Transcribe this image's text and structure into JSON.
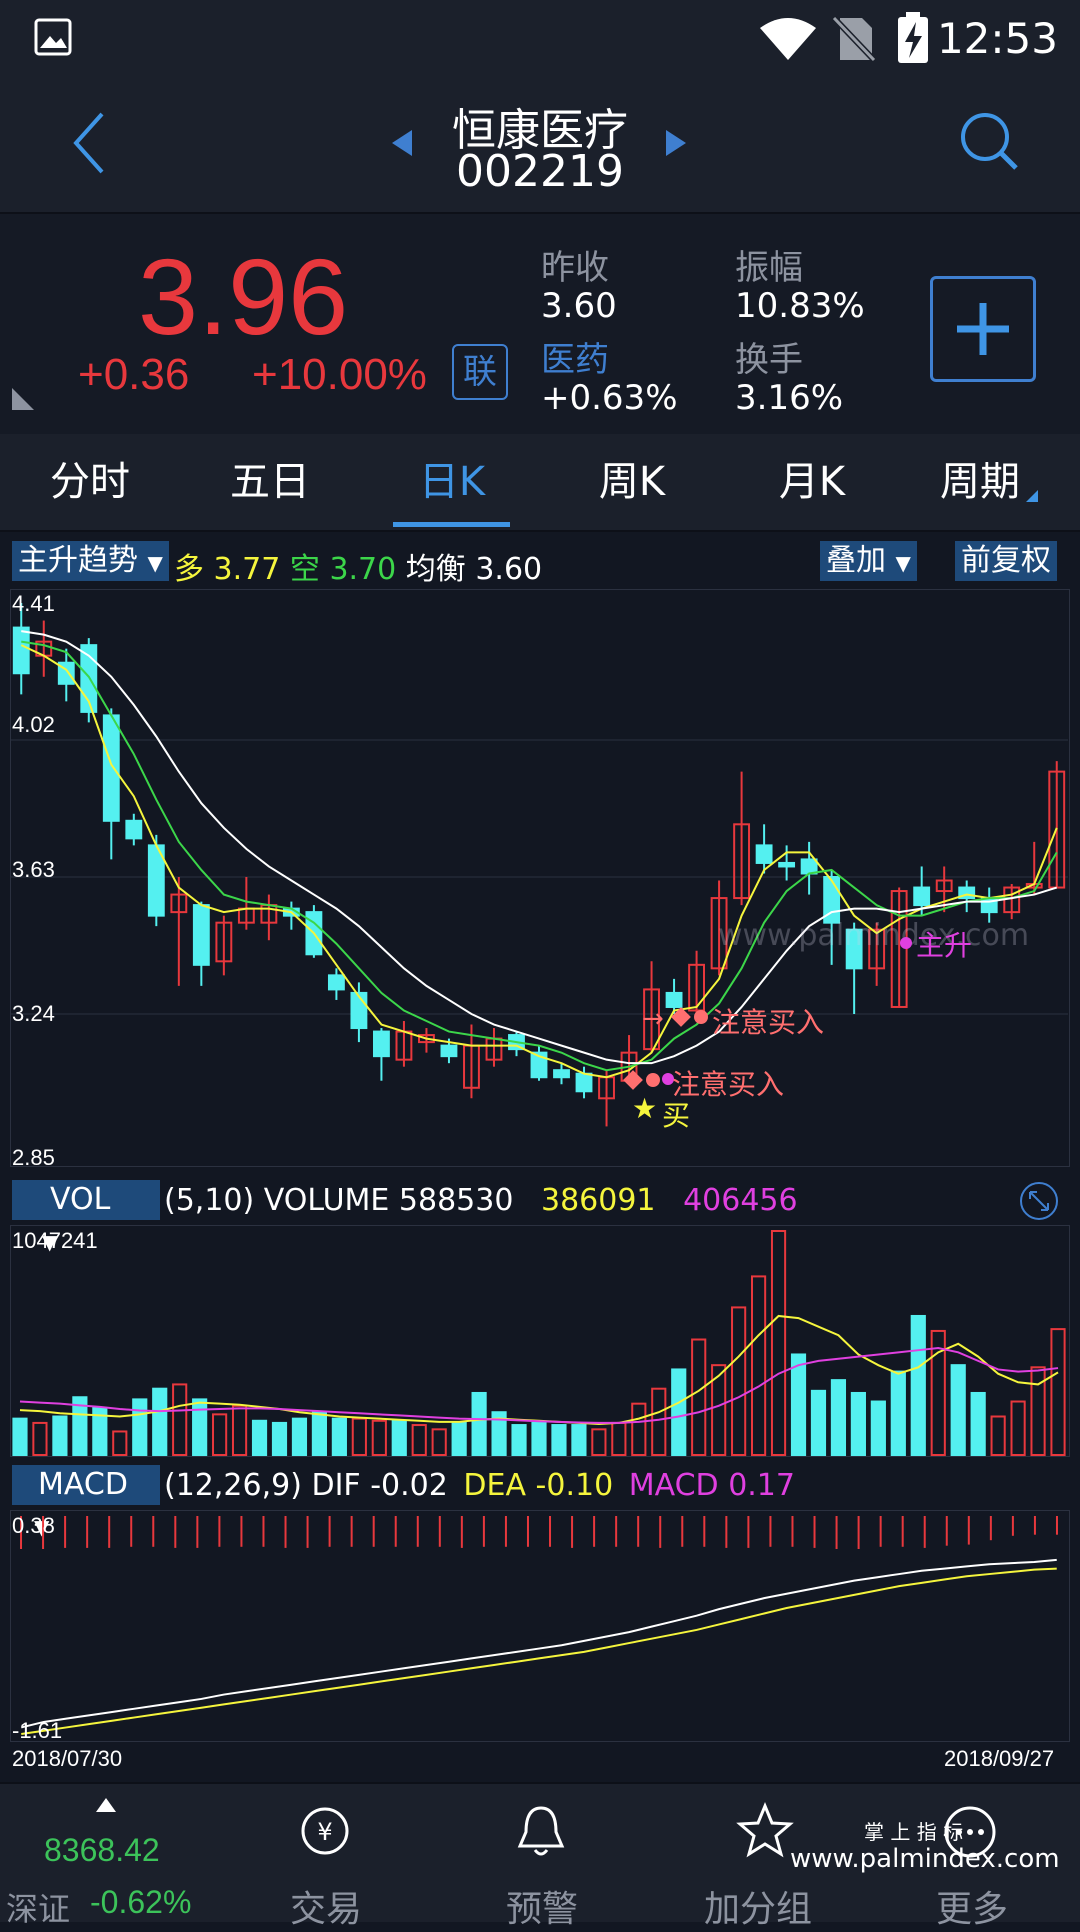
{
  "status": {
    "time": "12:53"
  },
  "header": {
    "stock_name": "恒康医疗",
    "stock_code": "002219"
  },
  "quote": {
    "price": "3.96",
    "change": "+0.36",
    "change_pct": "+10.00%",
    "lian_label": "联",
    "prev_close_label": "昨收",
    "prev_close": "3.60",
    "amplitude_label": "振幅",
    "amplitude": "10.83%",
    "sector_label": "医药",
    "sector_change": "+0.63%",
    "turnover_label": "换手",
    "turnover": "3.16%"
  },
  "tabs": [
    "分时",
    "五日",
    "日K",
    "周K",
    "月K",
    "周期"
  ],
  "active_tab": "日K",
  "main_indicator": {
    "selector": "主升趋势",
    "duo_label": "多",
    "duo_value": "3.77",
    "kong_label": "空",
    "kong_value": "3.70",
    "junheng_label": "均衡",
    "junheng_value": "3.60",
    "overlay_btn": "叠加",
    "adjust_btn": "前复权"
  },
  "vol_indicator": {
    "selector": "VOL",
    "params": "(5,10) VOLUME",
    "volume": "588530",
    "ma5": "386091",
    "ma10": "406456"
  },
  "macd_indicator": {
    "selector": "MACD",
    "params": "(12,26,9)",
    "dif_label": "DIF",
    "dif": "-0.02",
    "dea_label": "DEA",
    "dea": "-0.10",
    "macd_label": "MACD",
    "macd": "0.17"
  },
  "annotations": {
    "signal1": "注意买入",
    "signal2": "注意买入",
    "buy": "买",
    "zhusheng": "主升"
  },
  "dates": {
    "start": "2018/07/30",
    "end": "2018/09/27"
  },
  "bottom_nav": {
    "index_value": "8368.42",
    "index_name": "深证",
    "index_change": "-0.62%",
    "items": [
      "交易",
      "预警",
      "加分组",
      "更多"
    ]
  },
  "watermarks": {
    "center": "www.palmindex.com",
    "corner_title": "掌 上 指 标",
    "corner_url": "www.palmindex.com"
  },
  "colors": {
    "up": "#e8383d",
    "down": "#54f0f0",
    "accent": "#3f95e5",
    "ma_yellow": "#f5f53d",
    "ma_green": "#3cd64a",
    "ma_white": "#ffffff",
    "ma_magenta": "#e040e0"
  },
  "chart_data": [
    {
      "type": "candlestick",
      "title": "日K",
      "y_ticks": [
        "4.41",
        "4.02",
        "3.63",
        "3.24",
        "2.85"
      ],
      "ylim": [
        2.85,
        4.41
      ],
      "candles": [
        {
          "o": 4.34,
          "c": 4.21,
          "h": 4.41,
          "l": 4.15
        },
        {
          "o": 4.26,
          "c": 4.3,
          "h": 4.36,
          "l": 4.2
        },
        {
          "o": 4.24,
          "c": 4.18,
          "h": 4.28,
          "l": 4.13
        },
        {
          "o": 4.29,
          "c": 4.1,
          "h": 4.31,
          "l": 4.07
        },
        {
          "o": 4.09,
          "c": 3.79,
          "h": 4.11,
          "l": 3.68
        },
        {
          "o": 3.79,
          "c": 3.74,
          "h": 3.81,
          "l": 3.72
        },
        {
          "o": 3.72,
          "c": 3.52,
          "h": 3.75,
          "l": 3.49
        },
        {
          "o": 3.53,
          "c": 3.58,
          "h": 3.63,
          "l": 3.32
        },
        {
          "o": 3.55,
          "c": 3.38,
          "h": 3.56,
          "l": 3.32
        },
        {
          "o": 3.39,
          "c": 3.5,
          "h": 3.52,
          "l": 3.35
        },
        {
          "o": 3.5,
          "c": 3.54,
          "h": 3.63,
          "l": 3.48
        },
        {
          "o": 3.5,
          "c": 3.55,
          "h": 3.58,
          "l": 3.45
        },
        {
          "o": 3.54,
          "c": 3.52,
          "h": 3.56,
          "l": 3.48
        },
        {
          "o": 3.53,
          "c": 3.41,
          "h": 3.55,
          "l": 3.4
        },
        {
          "o": 3.35,
          "c": 3.31,
          "h": 3.37,
          "l": 3.28
        },
        {
          "o": 3.3,
          "c": 3.2,
          "h": 3.33,
          "l": 3.16
        },
        {
          "o": 3.19,
          "c": 3.12,
          "h": 3.2,
          "l": 3.05
        },
        {
          "o": 3.11,
          "c": 3.19,
          "h": 3.22,
          "l": 3.09
        },
        {
          "o": 3.16,
          "c": 3.18,
          "h": 3.2,
          "l": 3.13
        },
        {
          "o": 3.15,
          "c": 3.12,
          "h": 3.17,
          "l": 3.1
        },
        {
          "o": 3.03,
          "c": 3.15,
          "h": 3.21,
          "l": 3.0
        },
        {
          "o": 3.11,
          "c": 3.17,
          "h": 3.2,
          "l": 3.09
        },
        {
          "o": 3.18,
          "c": 3.14,
          "h": 3.19,
          "l": 3.12
        },
        {
          "o": 3.13,
          "c": 3.06,
          "h": 3.15,
          "l": 3.05
        },
        {
          "o": 3.08,
          "c": 3.06,
          "h": 3.1,
          "l": 3.04
        },
        {
          "o": 3.07,
          "c": 3.02,
          "h": 3.09,
          "l": 3.0
        },
        {
          "o": 3.0,
          "c": 3.06,
          "h": 3.08,
          "l": 2.92
        },
        {
          "o": 3.05,
          "c": 3.13,
          "h": 3.18,
          "l": 3.04
        },
        {
          "o": 3.14,
          "c": 3.31,
          "h": 3.39,
          "l": 3.13
        },
        {
          "o": 3.3,
          "c": 3.26,
          "h": 3.34,
          "l": 3.24
        },
        {
          "o": 3.25,
          "c": 3.38,
          "h": 3.42,
          "l": 3.22
        },
        {
          "o": 3.37,
          "c": 3.57,
          "h": 3.62,
          "l": 3.35
        },
        {
          "o": 3.57,
          "c": 3.78,
          "h": 3.93,
          "l": 3.55
        },
        {
          "o": 3.72,
          "c": 3.67,
          "h": 3.78,
          "l": 3.64
        },
        {
          "o": 3.67,
          "c": 3.66,
          "h": 3.72,
          "l": 3.62
        },
        {
          "o": 3.68,
          "c": 3.64,
          "h": 3.73,
          "l": 3.58
        },
        {
          "o": 3.63,
          "c": 3.5,
          "h": 3.65,
          "l": 3.38
        },
        {
          "o": 3.48,
          "c": 3.37,
          "h": 3.5,
          "l": 3.24
        },
        {
          "o": 3.37,
          "c": 3.48,
          "h": 3.5,
          "l": 3.32
        },
        {
          "o": 3.26,
          "c": 3.59,
          "h": 3.6,
          "l": 3.26
        },
        {
          "o": 3.6,
          "c": 3.55,
          "h": 3.66,
          "l": 3.52
        },
        {
          "o": 3.59,
          "c": 3.62,
          "h": 3.66,
          "l": 3.53
        },
        {
          "o": 3.6,
          "c": 3.57,
          "h": 3.62,
          "l": 3.53
        },
        {
          "o": 3.57,
          "c": 3.53,
          "h": 3.6,
          "l": 3.5
        },
        {
          "o": 3.53,
          "c": 3.6,
          "h": 3.61,
          "l": 3.51
        },
        {
          "o": 3.6,
          "c": 3.61,
          "h": 3.73,
          "l": 3.58
        },
        {
          "o": 3.6,
          "c": 3.93,
          "h": 3.96,
          "l": 3.6
        }
      ],
      "series": [
        {
          "name": "多",
          "color": "#f5f53d",
          "values": [
            4.29,
            4.26,
            4.22,
            4.13,
            3.95,
            3.86,
            3.72,
            3.6,
            3.55,
            3.53,
            3.54,
            3.54,
            3.53,
            3.47,
            3.38,
            3.29,
            3.21,
            3.19,
            3.17,
            3.16,
            3.15,
            3.15,
            3.15,
            3.12,
            3.1,
            3.07,
            3.06,
            3.08,
            3.13,
            3.25,
            3.26,
            3.34,
            3.52,
            3.65,
            3.7,
            3.7,
            3.62,
            3.52,
            3.47,
            3.51,
            3.54,
            3.56,
            3.58,
            3.57,
            3.58,
            3.61,
            3.77
          ]
        },
        {
          "name": "空",
          "color": "#3cd64a",
          "values": [
            4.3,
            4.29,
            4.27,
            4.2,
            4.09,
            3.98,
            3.85,
            3.73,
            3.65,
            3.58,
            3.56,
            3.55,
            3.54,
            3.5,
            3.44,
            3.37,
            3.3,
            3.25,
            3.22,
            3.19,
            3.18,
            3.17,
            3.16,
            3.15,
            3.13,
            3.1,
            3.08,
            3.09,
            3.11,
            3.17,
            3.21,
            3.27,
            3.37,
            3.5,
            3.59,
            3.64,
            3.65,
            3.6,
            3.55,
            3.52,
            3.52,
            3.54,
            3.56,
            3.57,
            3.57,
            3.59,
            3.7
          ]
        },
        {
          "name": "均衡",
          "color": "#ffffff",
          "values": [
            4.33,
            4.32,
            4.3,
            4.26,
            4.2,
            4.12,
            4.03,
            3.93,
            3.84,
            3.77,
            3.71,
            3.66,
            3.62,
            3.58,
            3.54,
            3.49,
            3.43,
            3.37,
            3.32,
            3.28,
            3.24,
            3.21,
            3.19,
            3.17,
            3.15,
            3.13,
            3.11,
            3.1,
            3.1,
            3.12,
            3.15,
            3.19,
            3.26,
            3.34,
            3.42,
            3.49,
            3.53,
            3.54,
            3.54,
            3.53,
            3.54,
            3.55,
            3.56,
            3.56,
            3.57,
            3.58,
            3.6
          ]
        }
      ]
    },
    {
      "type": "bar",
      "title": "VOL",
      "y_ticks": [
        "1047241"
      ],
      "ylim": [
        0,
        1047241
      ],
      "values": [
        170000,
        150000,
        180000,
        270000,
        220000,
        110000,
        260000,
        310000,
        330000,
        260000,
        190000,
        230000,
        160000,
        150000,
        170000,
        200000,
        170000,
        170000,
        160000,
        160000,
        140000,
        120000,
        150000,
        290000,
        200000,
        140000,
        150000,
        140000,
        140000,
        120000,
        150000,
        240000,
        310000,
        400000,
        540000,
        420000,
        690000,
        835000,
        1047241,
        470000,
        300000,
        350000,
        290000,
        250000,
        390000,
        650000,
        580000,
        420000,
        290000,
        180000,
        250000,
        410000,
        588530
      ],
      "up": [
        false,
        true,
        false,
        false,
        false,
        true,
        false,
        false,
        true,
        false,
        true,
        true,
        false,
        false,
        false,
        false,
        false,
        true,
        true,
        false,
        true,
        true,
        false,
        false,
        false,
        false,
        false,
        false,
        false,
        true,
        true,
        true,
        true,
        false,
        true,
        true,
        true,
        true,
        true,
        false,
        false,
        false,
        false,
        false,
        false,
        false,
        true,
        false,
        false,
        true,
        true,
        true,
        true
      ],
      "series": [
        {
          "name": "MA5",
          "color": "#f5f53d",
          "values": [
            210000,
            205000,
            195000,
            190000,
            185000,
            180000,
            190000,
            205000,
            230000,
            245000,
            240000,
            235000,
            225000,
            215000,
            200000,
            190000,
            180000,
            175000,
            170000,
            165000,
            160000,
            155000,
            155000,
            165000,
            170000,
            165000,
            160000,
            155000,
            150000,
            145000,
            150000,
            170000,
            200000,
            245000,
            300000,
            370000,
            460000,
            560000,
            650000,
            640000,
            600000,
            560000,
            470000,
            420000,
            380000,
            410000,
            480000,
            520000,
            460000,
            380000,
            340000,
            330000,
            386091
          ]
        },
        {
          "name": "MA10",
          "color": "#e040e0",
          "values": [
            250000,
            245000,
            240000,
            232000,
            225000,
            215000,
            208000,
            205000,
            208000,
            212000,
            215000,
            218000,
            218000,
            215000,
            210000,
            205000,
            200000,
            195000,
            190000,
            185000,
            180000,
            175000,
            170000,
            168000,
            166000,
            162000,
            158000,
            155000,
            152000,
            150000,
            150000,
            155000,
            165000,
            180000,
            200000,
            230000,
            270000,
            320000,
            380000,
            420000,
            440000,
            450000,
            460000,
            470000,
            480000,
            490000,
            500000,
            480000,
            440000,
            400000,
            390000,
            395000,
            406456
          ]
        }
      ]
    },
    {
      "type": "line",
      "title": "MACD",
      "y_ticks": [
        "0.38",
        "-1.61"
      ],
      "ylim": [
        -1.61,
        0.38
      ],
      "histogram": [
        0.3,
        0.3,
        0.29,
        0.29,
        0.29,
        0.28,
        0.28,
        0.29,
        0.29,
        0.28,
        0.28,
        0.28,
        0.29,
        0.29,
        0.28,
        0.28,
        0.28,
        0.28,
        0.28,
        0.28,
        0.29,
        0.28,
        0.28,
        0.28,
        0.28,
        0.29,
        0.28,
        0.28,
        0.28,
        0.29,
        0.28,
        0.28,
        0.29,
        0.29,
        0.28,
        0.28,
        0.29,
        0.3,
        0.3,
        0.28,
        0.28,
        0.29,
        0.27,
        0.26,
        0.22,
        0.18,
        0.17,
        0.17
      ],
      "series": [
        {
          "name": "DIF",
          "color": "#ffffff",
          "values": [
            -1.55,
            -1.5,
            -1.47,
            -1.44,
            -1.41,
            -1.38,
            -1.35,
            -1.32,
            -1.29,
            -1.25,
            -1.22,
            -1.19,
            -1.16,
            -1.13,
            -1.1,
            -1.07,
            -1.04,
            -1.01,
            -0.98,
            -0.95,
            -0.92,
            -0.89,
            -0.86,
            -0.83,
            -0.8,
            -0.76,
            -0.72,
            -0.68,
            -0.63,
            -0.58,
            -0.53,
            -0.47,
            -0.42,
            -0.37,
            -0.33,
            -0.29,
            -0.25,
            -0.21,
            -0.18,
            -0.15,
            -0.12,
            -0.1,
            -0.08,
            -0.06,
            -0.05,
            -0.04,
            -0.02
          ]
        },
        {
          "name": "DEA",
          "color": "#f5f53d",
          "values": [
            -1.61,
            -1.58,
            -1.55,
            -1.52,
            -1.49,
            -1.46,
            -1.43,
            -1.4,
            -1.37,
            -1.34,
            -1.31,
            -1.28,
            -1.25,
            -1.22,
            -1.19,
            -1.16,
            -1.13,
            -1.1,
            -1.07,
            -1.04,
            -1.01,
            -0.98,
            -0.95,
            -0.92,
            -0.89,
            -0.86,
            -0.82,
            -0.78,
            -0.74,
            -0.7,
            -0.66,
            -0.61,
            -0.56,
            -0.51,
            -0.46,
            -0.42,
            -0.38,
            -0.34,
            -0.3,
            -0.26,
            -0.23,
            -0.2,
            -0.17,
            -0.15,
            -0.13,
            -0.11,
            -0.1
          ]
        }
      ]
    }
  ]
}
